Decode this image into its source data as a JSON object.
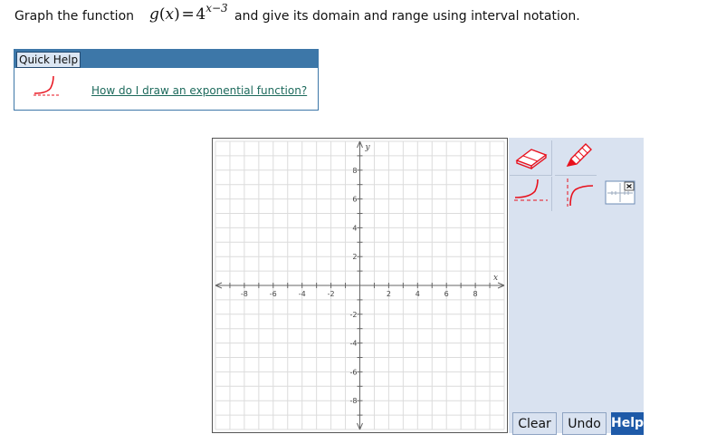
{
  "question": {
    "prefix": "Graph the function",
    "function_name": "g",
    "variable": "x",
    "base": "4",
    "exponent": "x−3",
    "suffix": "and give its domain and range using interval notation."
  },
  "quick_help": {
    "tab_label": "Quick Help",
    "link_text": "How do I draw an exponential function?",
    "icon": "exponential-curve-icon"
  },
  "graph": {
    "x_axis_label": "x",
    "y_axis_label": "y",
    "x_ticks": [
      "-8",
      "-6",
      "-4",
      "-2",
      "2",
      "4",
      "6",
      "8"
    ],
    "y_ticks": [
      "8",
      "6",
      "4",
      "2",
      "-2",
      "-4",
      "-6",
      "-8"
    ],
    "range": [
      -10,
      10
    ],
    "grid": true
  },
  "tools": [
    {
      "name": "eraser-icon"
    },
    {
      "name": "pencil-icon"
    },
    {
      "name": "exponential-tool-icon"
    },
    {
      "name": "logarithmic-tool-icon"
    },
    {
      "name": "interval-answer-icon"
    }
  ],
  "buttons": {
    "clear": "Clear",
    "undo": "Undo",
    "help": "Help"
  },
  "colors": {
    "accent_blue": "#3d77a8",
    "tool_panel": "#d9e2f0",
    "help_button": "#1e5aa8",
    "curve_red": "#e8101c",
    "link": "#1d6a5c"
  }
}
